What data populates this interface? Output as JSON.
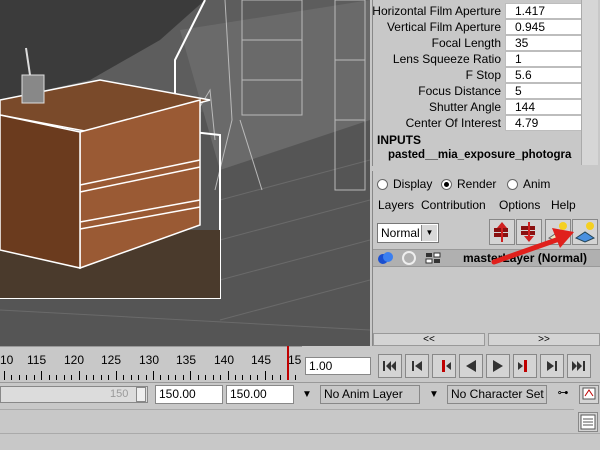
{
  "attributes": [
    {
      "label": "Horizontal Film Aperture",
      "value": "1.417"
    },
    {
      "label": "Vertical Film Aperture",
      "value": "0.945"
    },
    {
      "label": "Focal Length",
      "value": "35"
    },
    {
      "label": "Lens Squeeze Ratio",
      "value": "1"
    },
    {
      "label": "F Stop",
      "value": "5.6"
    },
    {
      "label": "Focus Distance",
      "value": "5"
    },
    {
      "label": "Shutter Angle",
      "value": "144"
    },
    {
      "label": "Center Of Interest",
      "value": "4.79"
    }
  ],
  "inputs": {
    "label": "INPUTS",
    "node": "pasted__mia_exposure_photogra"
  },
  "layer_editor": {
    "modes": [
      "Display",
      "Render",
      "Anim"
    ],
    "selected_mode": "Render",
    "menu": [
      "Layers",
      "Contribution",
      "Options",
      "Help"
    ],
    "blend_mode": "Normal",
    "layer_name": "masterLayer (Normal)",
    "nav_left": "<<",
    "nav_right": ">>"
  },
  "timeline": {
    "ticks": [
      "10",
      "115",
      "120",
      "125",
      "130",
      "135",
      "140",
      "145",
      "15"
    ],
    "current_frame": "1.00"
  },
  "range": {
    "end_label": "150",
    "end_time": "150.00",
    "anim_end": "150.00",
    "anim_layer": "No Anim Layer",
    "character_set": "No Character Set"
  },
  "colors": {
    "annotation_arrow": "#e0201c"
  },
  "icons": {
    "playback": [
      "skip-to-start-icon",
      "step-back-icon",
      "prev-key-icon",
      "play-backward-icon",
      "play-forward-icon",
      "next-key-icon",
      "step-forward-icon",
      "skip-to-end-icon"
    ],
    "layer_tools": [
      "move-up-layer-icon",
      "move-down-layer-icon",
      "new-empty-layer-icon",
      "new-layer-from-selected-icon"
    ]
  }
}
